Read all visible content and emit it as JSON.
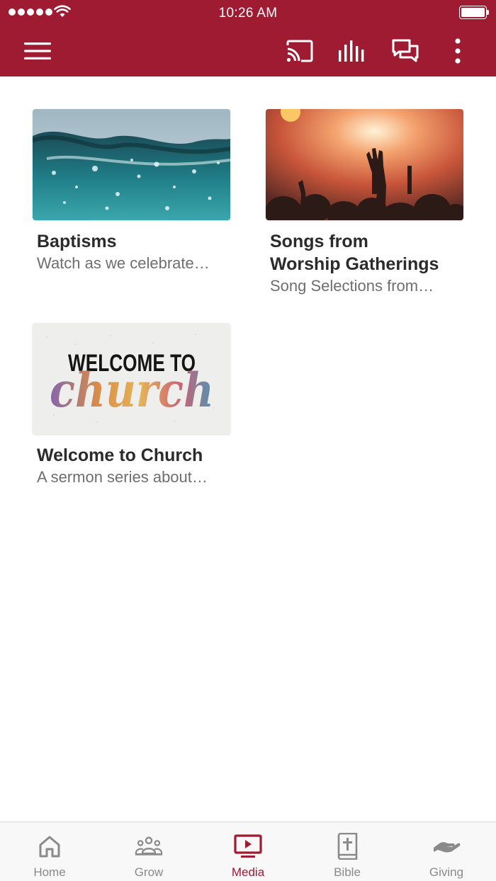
{
  "status_bar": {
    "time": "10:26 AM"
  },
  "colors": {
    "brand": "#9e1b32",
    "inactive": "#8a8a8a",
    "title": "#2b2b2b",
    "subtitle": "#6e6e6e"
  },
  "toolbar": {
    "icons": [
      "menu-icon",
      "cast-icon",
      "audio-bars-icon",
      "chat-bubbles-icon",
      "more-vertical-icon"
    ]
  },
  "series": [
    {
      "title_lines": [
        "Baptisms"
      ],
      "subtitle": "Watch as we celebrate…",
      "thumbnail": "ocean-water-image"
    },
    {
      "title_lines": [
        "Songs from",
        "Worship Gatherings"
      ],
      "subtitle": "Song Selections from…",
      "thumbnail": "concert-crowd-image"
    },
    {
      "title_lines": [
        "Welcome to Church"
      ],
      "subtitle": "A sermon series about…",
      "thumbnail": "welcome-to-church-artwork",
      "artwork_text": {
        "line1": "WELCOME TO",
        "line2": "church"
      }
    }
  ],
  "tabs": [
    {
      "label": "Home",
      "icon": "home-icon",
      "active": false
    },
    {
      "label": "Grow",
      "icon": "people-group-icon",
      "active": false
    },
    {
      "label": "Media",
      "icon": "tv-play-icon",
      "active": true
    },
    {
      "label": "Bible",
      "icon": "bible-icon",
      "active": false
    },
    {
      "label": "Giving",
      "icon": "giving-hand-icon",
      "active": false
    }
  ]
}
